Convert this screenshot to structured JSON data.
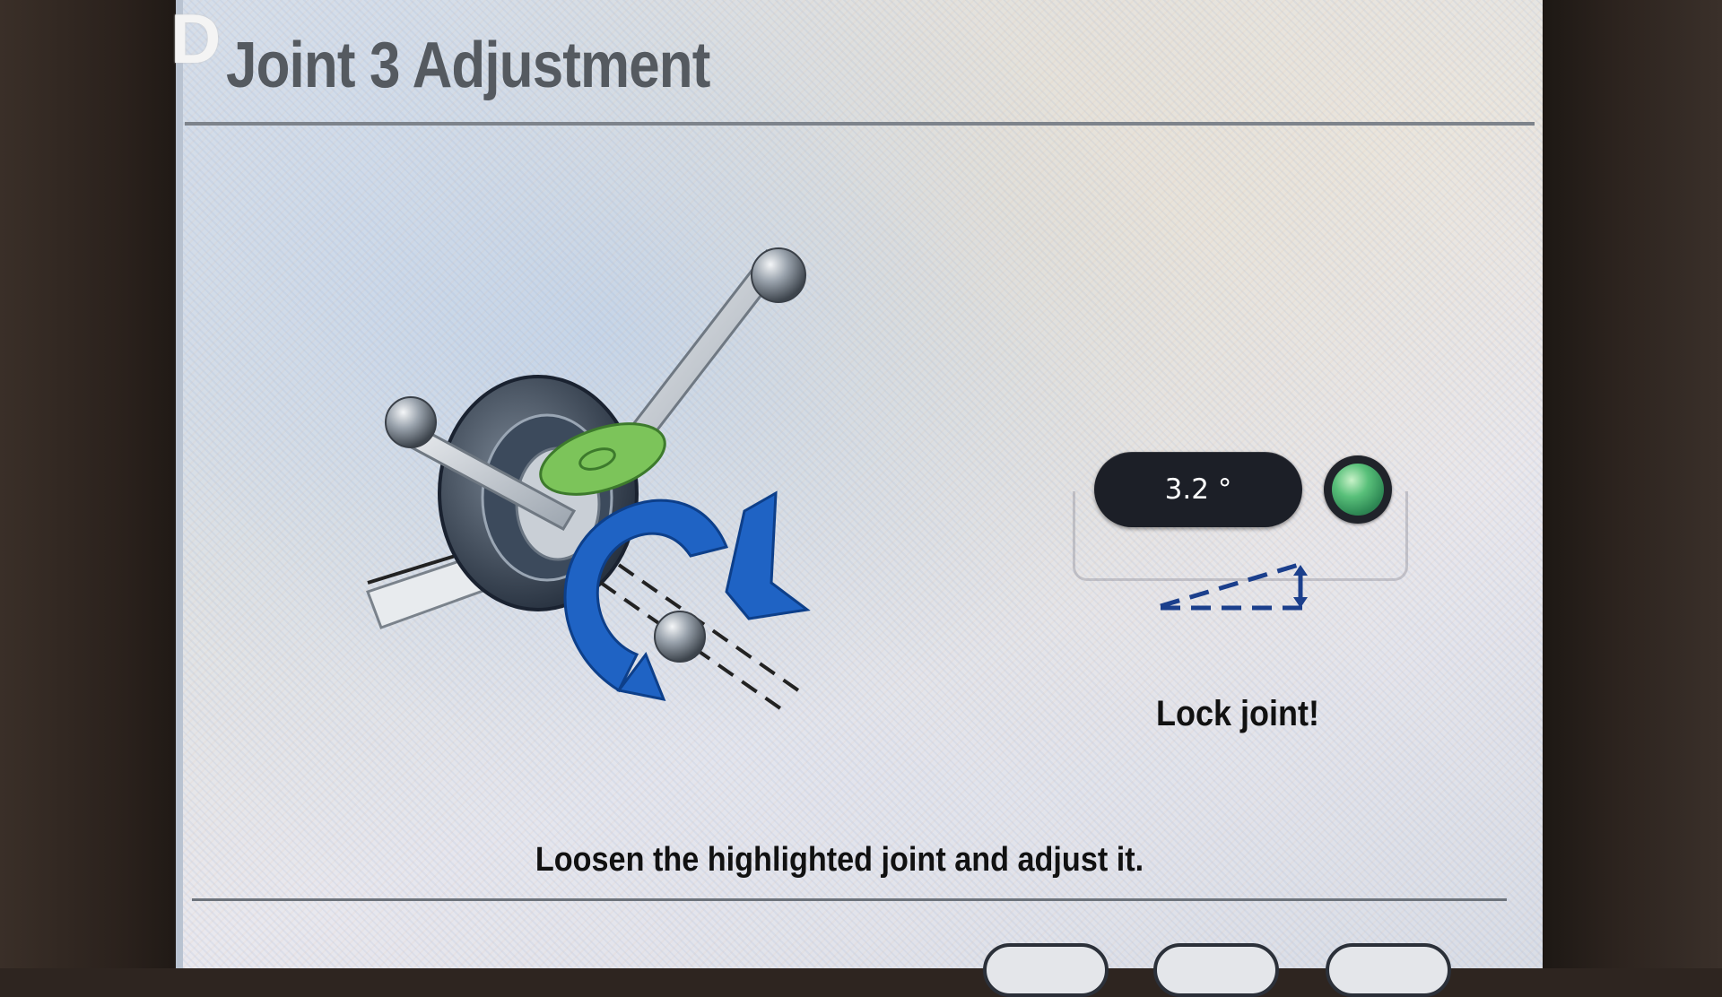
{
  "header": {
    "logo_letter": "D",
    "title": "Joint 3 Adjustment"
  },
  "illustration": {
    "subject": "Adjustable joint with three markers, highlighted joint in green, rotation arrows in blue",
    "accent_colors": {
      "highlight": "#7cc45a",
      "arrows": "#1f63c4"
    }
  },
  "reading": {
    "angle_value": "3.2 °",
    "status_icon": "status-light-icon",
    "status_color": "#4caf6a",
    "tilt_icon": "tilt-angle-icon",
    "status_text": "Lock joint!"
  },
  "footer": {
    "instruction": "Loosen the highlighted joint and adjust it."
  }
}
